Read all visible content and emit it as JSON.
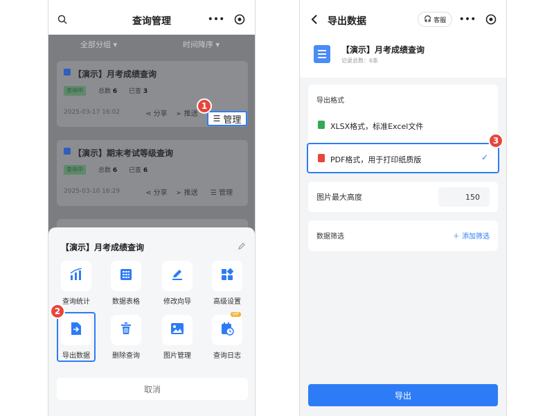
{
  "left": {
    "title": "查询管理",
    "filters": {
      "group": "全部分组 ▾",
      "sort": "时间降序 ▾"
    },
    "cards": [
      {
        "title": "【演示】月考成绩查询",
        "status": "查询中",
        "records_label": "总数",
        "records": "6",
        "queried_label": "已查",
        "queried": "3",
        "date": "2025-03-17 16:02",
        "share": "分享",
        "push": "推送",
        "manage": "管理"
      },
      {
        "title": "【演示】期末考试等级查询",
        "status": "查询中",
        "records_label": "总数",
        "records": "6",
        "queried_label": "已查",
        "queried": "6",
        "date": "2025-03-10 16:29",
        "share": "分享",
        "push": "推送",
        "manage": "管理"
      }
    ],
    "manage_highlight": "管理",
    "sheet": {
      "title": "【演示】月考成绩查询",
      "items": [
        {
          "label": "查询统计",
          "icon": "chart-icon"
        },
        {
          "label": "数据表格",
          "icon": "calculator-icon"
        },
        {
          "label": "修改向导",
          "icon": "pen-icon"
        },
        {
          "label": "高级设置",
          "icon": "grid-icon"
        },
        {
          "label": "导出数据",
          "icon": "export-file-icon"
        },
        {
          "label": "删除查询",
          "icon": "trash-icon"
        },
        {
          "label": "图片管理",
          "icon": "image-icon"
        },
        {
          "label": "查询日志",
          "icon": "log-icon"
        }
      ],
      "vip_badge": "VIP",
      "cancel": "取消"
    }
  },
  "right": {
    "title": "导出数据",
    "service": "客服",
    "head": {
      "title": "【演示】月考成绩查询",
      "subtitle": "记录总数：6条"
    },
    "export_format_label": "导出格式",
    "formats": [
      {
        "label": "XLSX格式，标准Excel文件",
        "color": "#34a853"
      },
      {
        "label": "PDF格式，用于打印纸质版",
        "color": "#e8453c",
        "selected": true
      }
    ],
    "height_label": "图片最大高度",
    "height_value": "150",
    "filter_label": "数据筛选",
    "add_filter": "＋ 添加筛选",
    "export_button": "导出"
  },
  "markers": [
    "1",
    "2",
    "3"
  ],
  "colors": {
    "accent": "#2d7cf6",
    "marker": "#e8453c"
  }
}
